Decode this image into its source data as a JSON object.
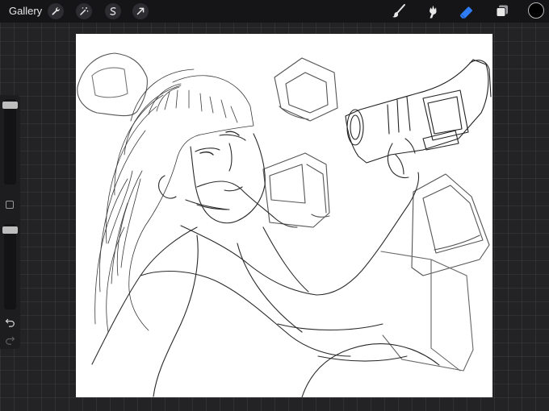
{
  "topbar": {
    "gallery_label": "Gallery",
    "left_tools": [
      "wrench-icon",
      "magic-wand-icon",
      "selection-icon",
      "transform-arrow-icon"
    ],
    "right_tools": [
      "brush-icon",
      "smudge-icon",
      "eraser-icon",
      "layers-icon"
    ],
    "active_tool": "eraser-icon",
    "current_color": "#000000",
    "accent_color": "#2f7df6"
  },
  "sidebar": {
    "brush_size_slider": "brush-size",
    "opacity_slider": "opacity",
    "controls": [
      "modify-button",
      "undo-icon",
      "redo-icon"
    ]
  },
  "canvas": {
    "background": "#ffffff",
    "content": "line-art-illustration"
  }
}
